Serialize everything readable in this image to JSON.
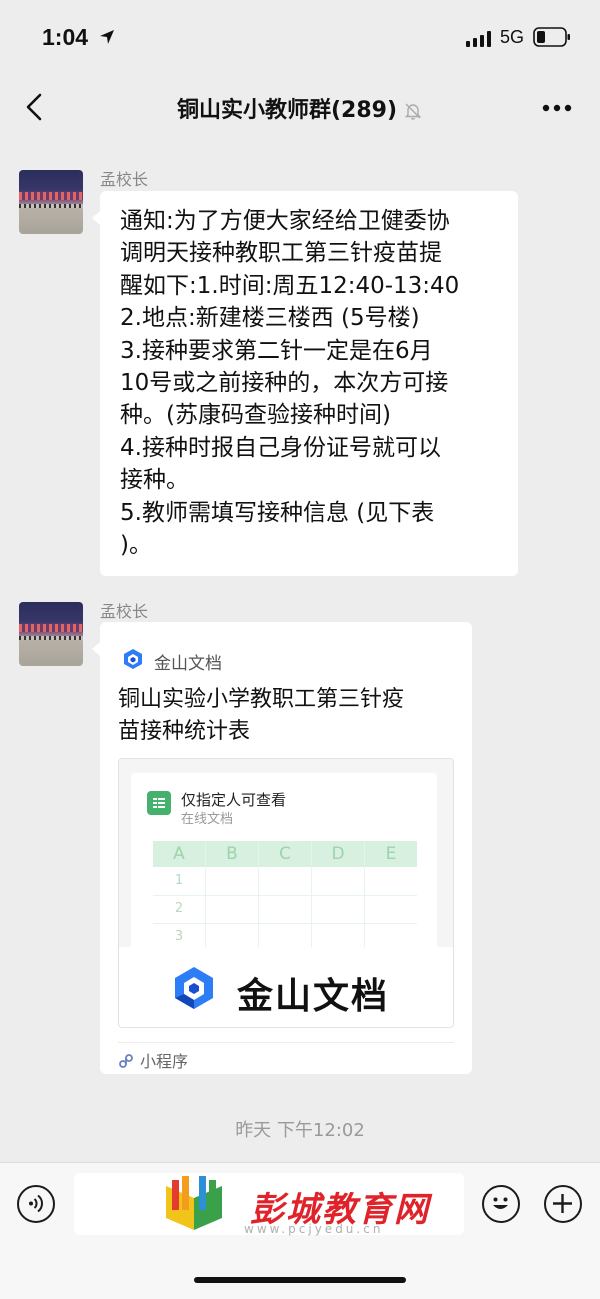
{
  "status_bar": {
    "time": "1:04",
    "network": "5G"
  },
  "nav": {
    "title": "铜山实小教师群(289)"
  },
  "messages": [
    {
      "sender": "孟校长",
      "type": "text",
      "lines": [
        "通知:为了方便大家经给卫健委协",
        "调明天接种教职工第三针疫苗提",
        "醒如下:1.时间:周五12:40-13:40",
        "2.地点:新建楼三楼西 (5号楼)",
        "3.接种要求第二针一定是在6月",
        "10号或之前接种的，本次方可接",
        "种。(苏康码查验接种时间)",
        "4.接种时报自己身份证号就可以",
        "接种。",
        "5.教师需填写接种信息 (见下表",
        ")。"
      ]
    },
    {
      "sender": "孟校长",
      "type": "mini-program-card",
      "source": "金山文档",
      "title_lines": [
        "铜山实验小学教职工第三针疫",
        "苗接种统计表"
      ],
      "preview": {
        "permission": "仅指定人可查看",
        "doc_type": "在线文档",
        "columns": [
          "A",
          "B",
          "C",
          "D",
          "E"
        ],
        "rows": [
          "1",
          "2",
          "3"
        ],
        "brand": "金山文档"
      },
      "footer": "小程序"
    }
  ],
  "timestamp": "昨天 下午12:02",
  "watermark": {
    "name": "彭城教育网",
    "url": "www.pcjyedu.cn"
  }
}
